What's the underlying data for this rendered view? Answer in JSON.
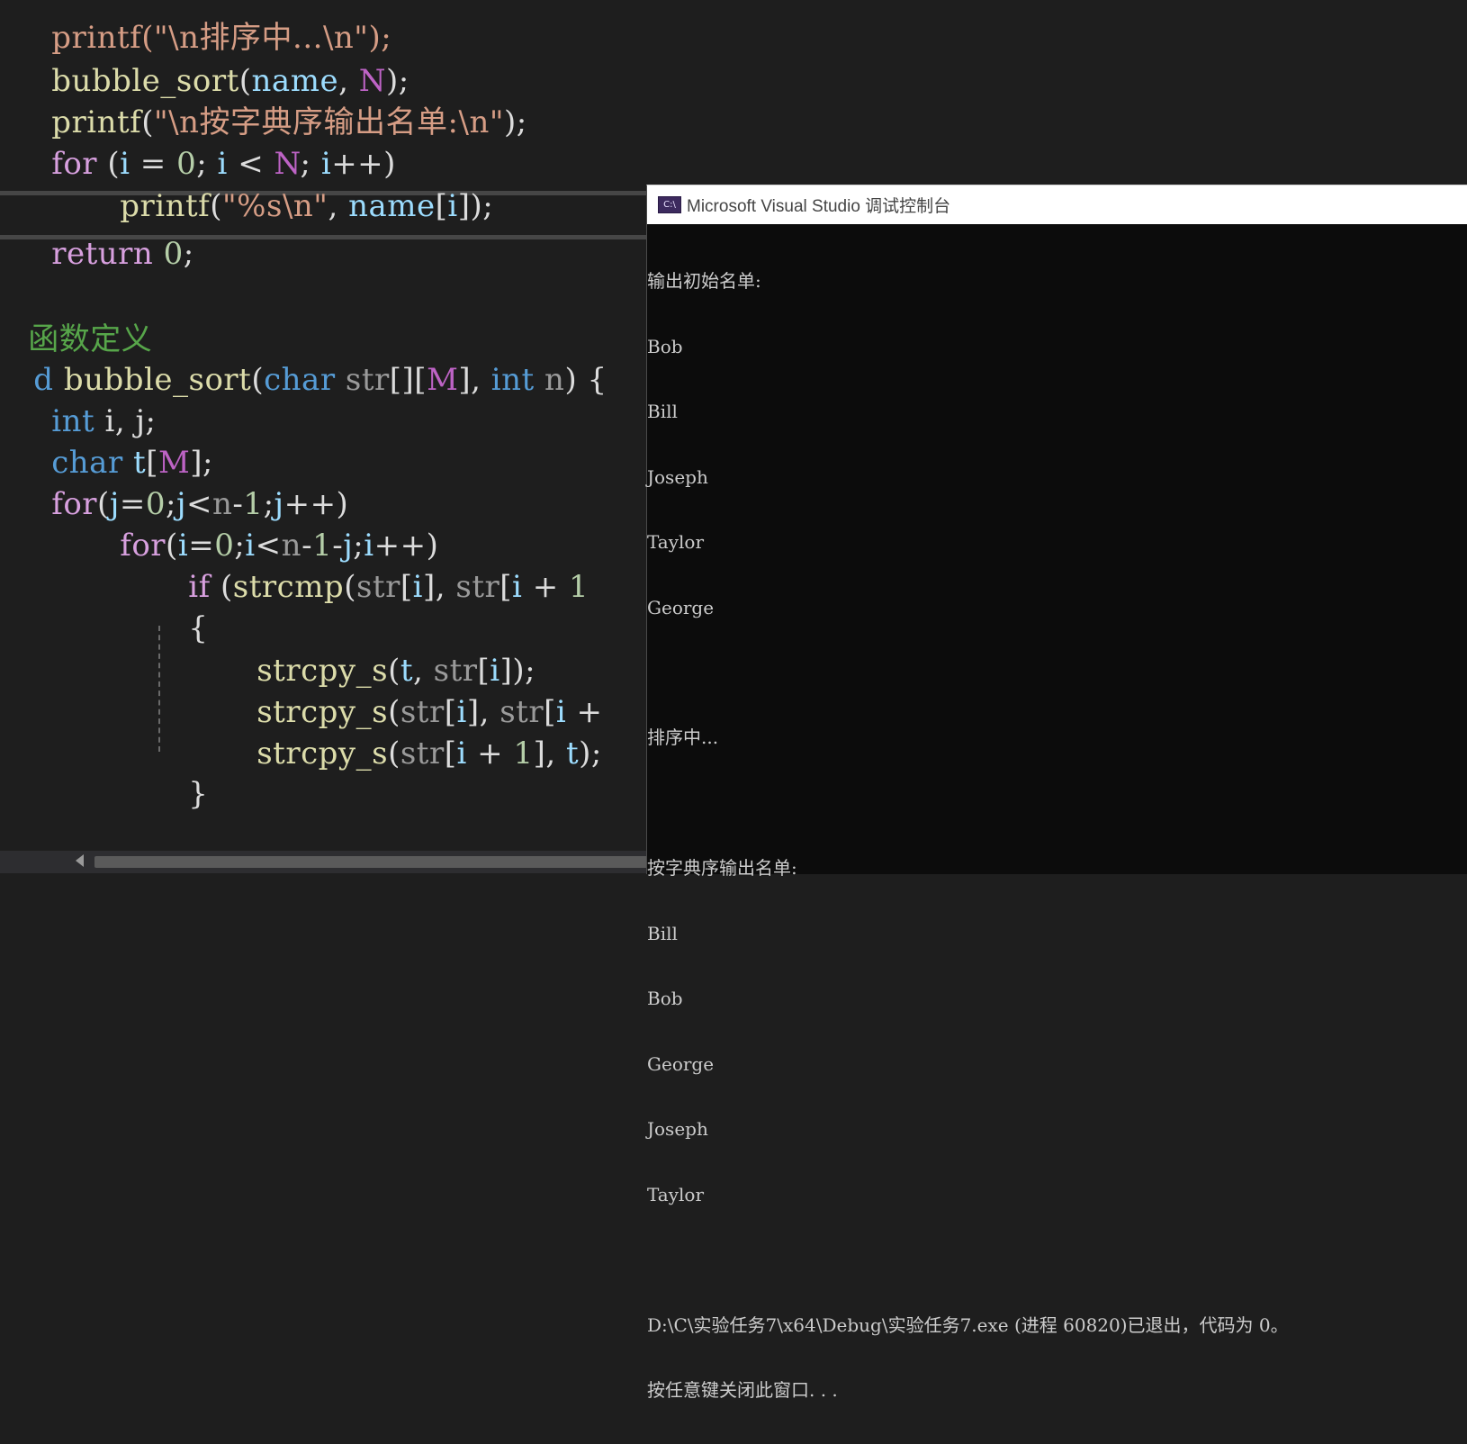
{
  "editor": {
    "line_partial": "printf(\"\\n排序中...\\n\");",
    "line_bubble_call": {
      "fn": "bubble_sort",
      "open": "(",
      "arg1": "name",
      "sep": ", ",
      "arg2": "N",
      "close": ");"
    },
    "line_printf_dict": {
      "fn": "printf",
      "open": "(",
      "str": "\"\\n按字典序输出名单:\\n\"",
      "close": ");"
    },
    "line_for_main": {
      "kw": "for",
      "rest_a": " (",
      "i1": "i",
      "eq": " = ",
      "zero": "0",
      "semi1": "; ",
      "i2": "i",
      "lt": " < ",
      "N": "N",
      "semi2": "; ",
      "i3": "i",
      "inc": "++)"
    },
    "line_printf_name": {
      "fn": "printf",
      "open": "(",
      "str": "\"%s\\n\"",
      "sep": ", ",
      "name": "name",
      "br_o": "[",
      "idx": "i",
      "br_c": "]);"
    },
    "line_return": {
      "kw": "return",
      "sp": " ",
      "val": "0",
      "semi": ";"
    },
    "comment_func_def": "函数定义",
    "line_signature": {
      "prefix": "d",
      "fn": "bubble_sort",
      "open": "(",
      "t1": "char",
      "p1": "str",
      "brk": "[][",
      "M": "M",
      "brk2": "], ",
      "t2": "int",
      "p2": "n",
      "close": ") {"
    },
    "line_int_ij": {
      "kw": "int",
      "rest": " i, j;"
    },
    "line_char_t": {
      "kw": "char",
      "sp": " ",
      "var": "t",
      "bo": "[",
      "M": "M",
      "bc": "];"
    },
    "line_for_j": {
      "kw": "for",
      "open": "(",
      "v1": "j",
      "eq": "=",
      "zero": "0",
      "s1": ";",
      "v2": "j",
      "lt": "<",
      "n": "n",
      "m1": "-",
      "one": "1",
      "s2": ";",
      "v3": "j",
      "inc": "++)"
    },
    "line_for_i": {
      "kw": "for",
      "open": "(",
      "v1": "i",
      "eq": "=",
      "zero": "0",
      "s1": ";",
      "v2": "i",
      "lt": "<",
      "n": "n",
      "m1": "-",
      "one": "1",
      "m2": "-",
      "j": "j",
      "s2": ";",
      "v3": "i",
      "inc": "++)"
    },
    "line_if": {
      "kw": "if",
      "sp": " (",
      "fn": "strcmp",
      "open": "(",
      "p1": "str",
      "bo": "[",
      "i": "i",
      "bc": "], ",
      "p2": "str",
      "bo2": "[",
      "i2": "i",
      "plus": " + ",
      "one": "1"
    },
    "line_brace_open": "{",
    "line_strcpy1": {
      "fn": "strcpy_s",
      "open": "(",
      "t": "t",
      "sep": ", ",
      "p": "str",
      "bo": "[",
      "i": "i",
      "bc": "]);"
    },
    "line_strcpy2": {
      "fn": "strcpy_s",
      "open": "(",
      "p": "str",
      "bo": "[",
      "i": "i",
      "bc": "], ",
      "p2": "str",
      "bo2": "[",
      "i2": "i",
      "plus": " +"
    },
    "line_strcpy3": {
      "fn": "strcpy_s",
      "open": "(",
      "p": "str",
      "bo": "[",
      "i": "i",
      "plus": " + ",
      "one": "1",
      "bc": "], ",
      "t": "t",
      "close": ");"
    },
    "line_brace_close": "}"
  },
  "console": {
    "title": "Microsoft Visual Studio 调试控制台",
    "icon_label": "C:\\",
    "lines": [
      "输出初始名单:",
      "Bob",
      "Bill",
      "Joseph",
      "Taylor",
      "George",
      "",
      "排序中...",
      "",
      "按字典序输出名单:",
      "Bill",
      "Bob",
      "George",
      "Joseph",
      "Taylor",
      "",
      "D:\\C\\实验任务7\\x64\\Debug\\实验任务7.exe (进程 60820)已退出，代码为 0。",
      "按任意键关闭此窗口. . ."
    ]
  },
  "colors": {
    "editor_bg": "#1e1e1e",
    "keyword": "#569cd6",
    "control": "#d8a0df",
    "function": "#dcdcaa",
    "string": "#d69d85",
    "number": "#b5cea8",
    "comment": "#57a64a",
    "console_bg": "#0c0c0c",
    "console_text": "#cccccc"
  }
}
